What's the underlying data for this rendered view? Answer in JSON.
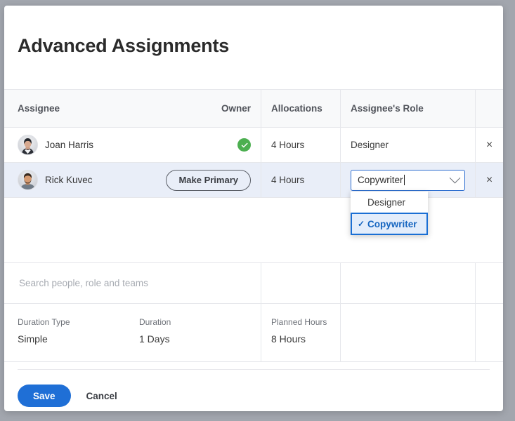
{
  "dialog": {
    "title": "Advanced Assignments"
  },
  "table": {
    "columns": {
      "assignee": "Assignee",
      "owner": "Owner",
      "allocations": "Allocations",
      "role": "Assignee's Role",
      "remove": ""
    },
    "rows": [
      {
        "name": "Joan Harris",
        "avatar_icon": "avatar-photo-woman",
        "owner_state": "owner",
        "owner_icon": "check-circle-icon",
        "allocations": "4 Hours",
        "role": "Designer",
        "remove_icon": "close-icon",
        "remove_label": "×",
        "selected": false
      },
      {
        "name": "Rick Kuvec",
        "avatar_icon": "avatar-photo-man",
        "owner_state": "not-owner",
        "make_primary_label": "Make Primary",
        "allocations": "4 Hours",
        "role": "Copywriter",
        "remove_icon": "close-icon",
        "remove_label": "×",
        "selected": true
      }
    ]
  },
  "role_dropdown": {
    "open": true,
    "selected": "Copywriter",
    "check_glyph": "✓",
    "options": [
      {
        "label": "Designer",
        "selected": false
      },
      {
        "label": "Copywriter",
        "selected": true
      }
    ]
  },
  "search": {
    "value": "",
    "placeholder": "Search people, role and teams",
    "icon": "search-icon"
  },
  "details": {
    "duration_type_label": "Duration Type",
    "duration_type_value": "Simple",
    "duration_label": "Duration",
    "duration_value": "1 Days",
    "planned_hours_label": "Planned Hours",
    "planned_hours_value": "8 Hours"
  },
  "footer": {
    "save_label": "Save",
    "cancel_label": "Cancel"
  },
  "colors": {
    "accent_blue": "#1f6fd6",
    "focus_border": "#2f6fd0",
    "selected_row": "#e9eef8",
    "owner_green": "#4caf50",
    "dropdown_selected_bg": "#e3edfb",
    "dropdown_selected_text": "#1565c0",
    "page_background": "#a2a6ae"
  }
}
